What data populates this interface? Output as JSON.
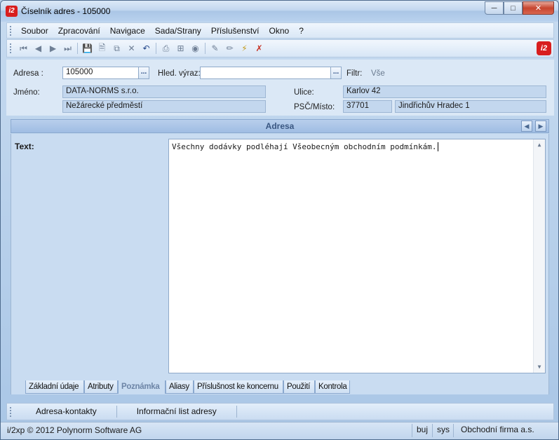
{
  "window": {
    "title": "Číselník adres - 105000",
    "app_icon": "i2-logo",
    "controls": [
      "minimize-icon",
      "maximize-icon",
      "close-icon"
    ]
  },
  "menubar": {
    "items": [
      "Soubor",
      "Zpracování",
      "Navigace",
      "Sada/Strany",
      "Příslušenství",
      "Okno",
      "?"
    ]
  },
  "toolbar": {
    "icons": [
      "first-record-icon",
      "previous-record-icon",
      "next-record-icon",
      "last-record-icon",
      "save-icon",
      "new-icon",
      "copy-icon",
      "delete-icon",
      "undo-icon",
      "print-icon",
      "tree-icon",
      "disabled-icon",
      "edit-icon",
      "edit-all-icon",
      "filter-icon",
      "clear-filter-icon"
    ],
    "logo": "i2-logo"
  },
  "form": {
    "adresa_label": "Adresa :",
    "adresa_value": "105000",
    "ellipsis_label": "...",
    "hled_label": "Hled. výraz:",
    "hled_value": "",
    "filtr_label": "Filtr:",
    "filtr_value": "Vše",
    "jmeno_label": "Jméno:",
    "jmeno_value": "DATA-NORMS s.r.o.",
    "jmeno2_value": "Nežárecké předměstí",
    "ulice_label": "Ulice:",
    "ulice_value": "Karlov 42",
    "psc_label": "PSČ/Místo:",
    "psc_value": "37701",
    "misto_value": "Jindřichův Hradec 1"
  },
  "section": {
    "title": "Adresa"
  },
  "note": {
    "label": "Text:",
    "value": "Všechny dodávky podléhají Všeobecným obchodním podmínkám."
  },
  "tabs": [
    {
      "label": "Základní údaje",
      "active": false
    },
    {
      "label": "Atributy",
      "active": false
    },
    {
      "label": "Poznámka",
      "active": true
    },
    {
      "label": "Aliasy",
      "active": false
    },
    {
      "label": "Příslušnost ke koncernu",
      "active": false
    },
    {
      "label": "Použití",
      "active": false
    },
    {
      "label": "Kontrola",
      "active": false
    }
  ],
  "actions": [
    "Adresa-kontakty",
    "Informační list adresy"
  ],
  "status": {
    "left": "i/2xp © 2012 Polynorm Software AG",
    "user": "buj",
    "db": "sys",
    "company": "Obchodní firma a.s."
  }
}
